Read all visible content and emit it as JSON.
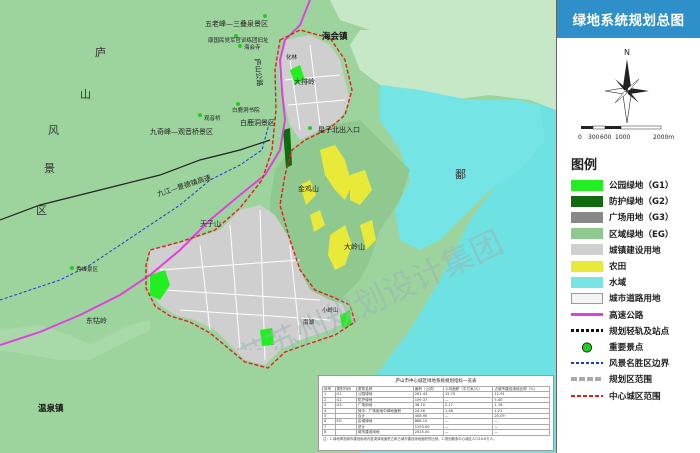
{
  "title": "绿地系统规划总图",
  "compass_letter": "N",
  "scale_bar": {
    "ticks": [
      "0",
      "300",
      "600",
      "1000",
      "2000m"
    ]
  },
  "legend": {
    "title": "图例",
    "items": [
      {
        "label": "公园绿地（G1）",
        "color": "#22ee22"
      },
      {
        "label": "防护绿地（G2）",
        "color": "#106b10"
      },
      {
        "label": "广场用地（G3）",
        "color": "#888888"
      },
      {
        "label": "区域绿地（EG）",
        "color": "#8fc98f"
      },
      {
        "label": "城镇建设用地",
        "color": "#cfcfcf"
      },
      {
        "label": "农田",
        "color": "#e9e93a"
      },
      {
        "label": "水域",
        "color": "#78e3e3"
      },
      {
        "label": "城市道路用地",
        "color": "#f4f4f4"
      },
      {
        "label": "高速公路",
        "color": "#e040e0"
      },
      {
        "label": "规划轻轨及站点",
        "color": "#111111"
      },
      {
        "label": "重要景点",
        "color": "#22cc22"
      },
      {
        "label": "风景名胜区边界",
        "color": "#1a3acb"
      },
      {
        "label": "规划区范围",
        "color": "#aaaaaa"
      },
      {
        "label": "中心城区范围",
        "color": "#e02020"
      }
    ]
  },
  "map_labels": {
    "lushan_1": "庐",
    "lushan_2": "山",
    "lushan_3": "风",
    "lushan_4": "景",
    "lushan_5": "区",
    "hai_hui": "海会镇",
    "wenquan": "温泉镇",
    "poyang": "鄱",
    "wulaofeng": "五老峰—三叠泉景区",
    "kangyuan": "康国民党军官训练团旧址",
    "haihuisi": "海会寺",
    "dapaling": "大排岭",
    "bailudong": "白鹿洞书院",
    "bailudong_area": "白鹿洞景区",
    "jiuqifeng": "九奇峰—观音桥景区",
    "guanyinqiao": "观音桥",
    "xingzi_north": "星子北出入口",
    "jinjishan": "金鸡山",
    "jiujing_gs": "九江—景德镇高速",
    "tianzishan": "天子山",
    "dahushan": "大岭山",
    "xiuhu": "秀峰景区",
    "dongguling": "东牯岭",
    "yuanhao_lu": "庐山公路",
    "hualin": "化林",
    "xiuhu_area": "南湖",
    "xiaolingshan": "小岭山"
  },
  "watermark": "江苏苏州规划设计集团",
  "table": {
    "title": "庐山市中心城区绿地系统规划指标一览表",
    "header": [
      "序号",
      "类别代码",
      "类别名称",
      "面积（公顷）",
      "人均面积（平方米/人）",
      "占城市建设用地比例（%）"
    ],
    "rows": [
      [
        "1",
        "G1",
        "公园绿地",
        "261.43",
        "15.75",
        "12.91"
      ],
      [
        "2",
        "G2",
        "防护绿地",
        "109.37",
        "—",
        "5.40"
      ],
      [
        "3",
        "G3",
        "广场用地",
        "36.10",
        "2.17",
        "1.78"
      ],
      [
        "4",
        "",
        "其中：广场用地中绿地面积",
        "24.56",
        "1.48",
        "1.21"
      ],
      [
        "5",
        "",
        "合计",
        "406.90",
        "—",
        "20.09"
      ],
      [
        "6",
        "EG",
        "区域绿地",
        "886.10",
        "—",
        "—"
      ],
      [
        "7",
        "",
        "总计",
        "1293.00",
        "—",
        "—"
      ],
      [
        "8",
        "",
        "城市建设用地",
        "2025.00",
        "—",
        "—"
      ]
    ],
    "note": "注：1.绿地率指城市建设用地内各类绿地面积之和占城市建设用地面积的比例。2.规划期末中心城区人口16.6万人。"
  }
}
